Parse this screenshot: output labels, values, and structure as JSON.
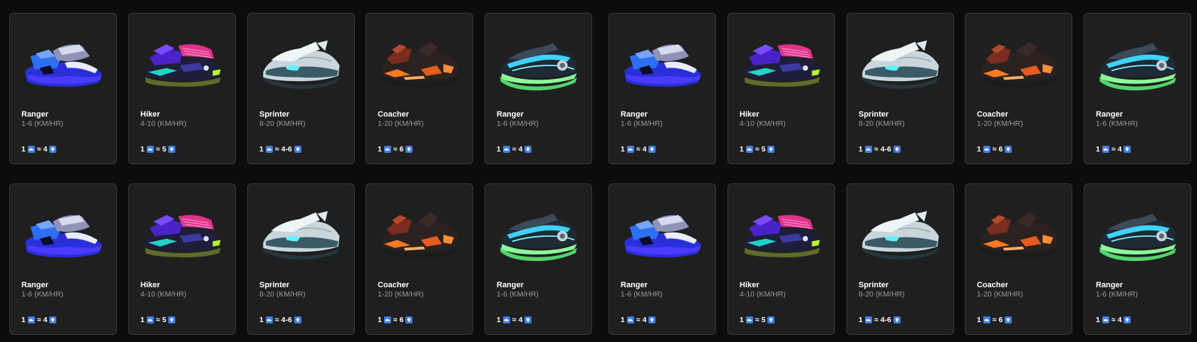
{
  "icons": {
    "sneaker": "sneaker-icon",
    "token": "gem-token-icon"
  },
  "colors": {
    "icon_bg": "#3f7fe6",
    "card_bg": "#1f1f20",
    "page_bg": "#0c0c0d"
  },
  "rows": [
    {
      "cards": [
        {
          "name": "Ranger",
          "speed": "1-6 (KM/HR)",
          "ratio_left": "1",
          "approx": "≈",
          "ratio_right": "4",
          "variant": "blue"
        },
        {
          "name": "Hiker",
          "speed": "4-10 (KM/HR)",
          "ratio_left": "1",
          "approx": "≈",
          "ratio_right": "5",
          "variant": "purple"
        },
        {
          "name": "Sprinter",
          "speed": "8-20 (KM/HR)",
          "ratio_left": "1",
          "approx": "≈",
          "ratio_right": "4-6",
          "variant": "white"
        },
        {
          "name": "Coacher",
          "speed": "1-20 (KM/HR)",
          "ratio_left": "1",
          "approx": "≈",
          "ratio_right": "6",
          "variant": "dark"
        },
        {
          "name": "Ranger",
          "speed": "1-6 (KM/HR)",
          "ratio_left": "1",
          "approx": "≈",
          "ratio_right": "4",
          "variant": "green"
        },
        {
          "name": "Ranger",
          "speed": "1-6 (KM/HR)",
          "ratio_left": "1",
          "approx": "≈",
          "ratio_right": "4",
          "variant": "blue"
        },
        {
          "name": "Hiker",
          "speed": "4-10 (KM/HR)",
          "ratio_left": "1",
          "approx": "≈",
          "ratio_right": "5",
          "variant": "purple"
        },
        {
          "name": "Sprinter",
          "speed": "8-20 (KM/HR)",
          "ratio_left": "1",
          "approx": "≈",
          "ratio_right": "4-6",
          "variant": "white"
        },
        {
          "name": "Coacher",
          "speed": "1-20 (KM/HR)",
          "ratio_left": "1",
          "approx": "≈",
          "ratio_right": "6",
          "variant": "dark"
        },
        {
          "name": "Ranger",
          "speed": "1-6 (KM/HR)",
          "ratio_left": "1",
          "approx": "≈",
          "ratio_right": "4",
          "variant": "green"
        }
      ]
    },
    {
      "cards": [
        {
          "name": "Ranger",
          "speed": "1-6 (KM/HR)",
          "ratio_left": "1",
          "approx": "≈",
          "ratio_right": "4",
          "variant": "blue"
        },
        {
          "name": "Hiker",
          "speed": "4-10 (KM/HR)",
          "ratio_left": "1",
          "approx": "≈",
          "ratio_right": "5",
          "variant": "purple"
        },
        {
          "name": "Sprinter",
          "speed": "8-20 (KM/HR)",
          "ratio_left": "1",
          "approx": "≈",
          "ratio_right": "4-6",
          "variant": "white"
        },
        {
          "name": "Coacher",
          "speed": "1-20 (KM/HR)",
          "ratio_left": "1",
          "approx": "≈",
          "ratio_right": "6",
          "variant": "dark"
        },
        {
          "name": "Ranger",
          "speed": "1-6 (KM/HR)",
          "ratio_left": "1",
          "approx": "≈",
          "ratio_right": "4",
          "variant": "green"
        },
        {
          "name": "Ranger",
          "speed": "1-6 (KM/HR)",
          "ratio_left": "1",
          "approx": "≈",
          "ratio_right": "4",
          "variant": "blue"
        },
        {
          "name": "Hiker",
          "speed": "4-10 (KM/HR)",
          "ratio_left": "1",
          "approx": "≈",
          "ratio_right": "5",
          "variant": "purple"
        },
        {
          "name": "Sprinter",
          "speed": "8-20 (KM/HR)",
          "ratio_left": "1",
          "approx": "≈",
          "ratio_right": "4-6",
          "variant": "white"
        },
        {
          "name": "Coacher",
          "speed": "1-20 (KM/HR)",
          "ratio_left": "1",
          "approx": "≈",
          "ratio_right": "6",
          "variant": "dark"
        },
        {
          "name": "Ranger",
          "speed": "1-6 (KM/HR)",
          "ratio_left": "1",
          "approx": "≈",
          "ratio_right": "4",
          "variant": "green"
        }
      ]
    }
  ]
}
